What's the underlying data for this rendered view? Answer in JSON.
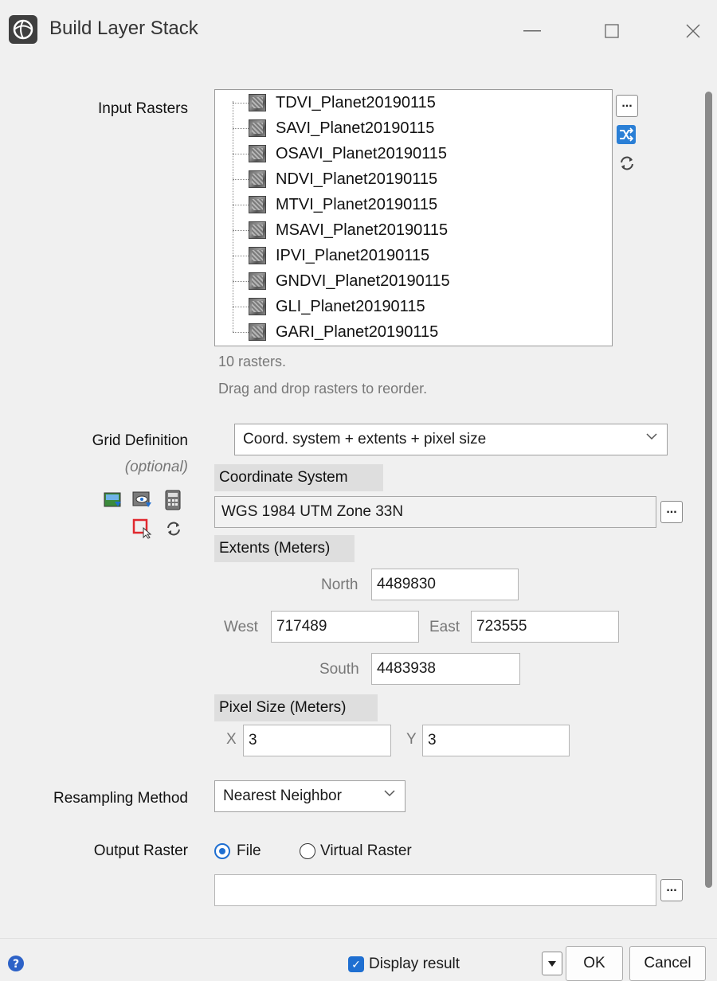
{
  "window": {
    "title": "Build Layer Stack"
  },
  "input_rasters": {
    "label": "Input Rasters",
    "items": [
      "TDVI_Planet20190115",
      "SAVI_Planet20190115",
      "OSAVI_Planet20190115",
      "NDVI_Planet20190115",
      "MTVI_Planet20190115",
      "MSAVI_Planet20190115",
      "IPVI_Planet20190115",
      "GNDVI_Planet20190115",
      "GLI_Planet20190115",
      "GARI_Planet20190115"
    ],
    "browse_label": "...",
    "count_text": "10 rasters.",
    "hint_text": "Drag and drop rasters to reorder."
  },
  "grid_definition": {
    "label": "Grid Definition",
    "optional_label": "(optional)",
    "mode_value": "Coord. system + extents + pixel size",
    "coord_system_header": "Coordinate System",
    "coord_system_value": "WGS 1984 UTM Zone 33N",
    "coord_browse_label": "...",
    "extents_header": "Extents (Meters)",
    "north_label": "North",
    "north_value": "4489830",
    "west_label": "West",
    "west_value": "717489",
    "east_label": "East",
    "east_value": "723555",
    "south_label": "South",
    "south_value": "4483938",
    "pixel_size_header": "Pixel Size (Meters)",
    "x_label": "X",
    "x_value": "3",
    "y_label": "Y",
    "y_value": "3"
  },
  "resampling": {
    "label": "Resampling Method",
    "value": "Nearest Neighbor"
  },
  "output": {
    "label": "Output Raster",
    "option_file": "File",
    "option_virtual": "Virtual Raster",
    "selected": "File",
    "path_value": "",
    "browse_label": "..."
  },
  "footer": {
    "display_result_label": "Display result",
    "display_result_checked": true,
    "ok_label": "OK",
    "cancel_label": "Cancel"
  },
  "colors": {
    "accent": "#1f6fd1",
    "section_header_bg": "#dedede",
    "background": "#f0f0f0"
  }
}
